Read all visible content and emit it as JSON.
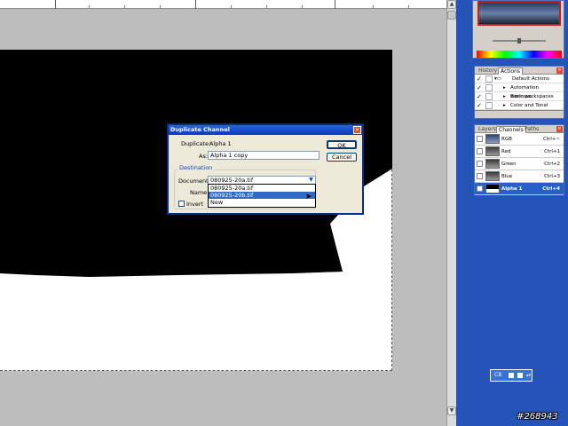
{
  "dialog": {
    "title": "Duplicate Channel",
    "close_glyph": "×",
    "duplicate_label": "Duplicate:",
    "duplicate_value": "Alpha 1",
    "as_label": "As:",
    "as_value": "Alpha 1 copy",
    "ok_label": "OK",
    "cancel_label": "Cancel",
    "destination_label": "Destination",
    "document_label": "Document:",
    "document_value": "080925-20a.tif",
    "name_label": "Name",
    "invert_label": "Invert",
    "dropdown_options": [
      "080925-20a.tif",
      "080925-20b.tif",
      "New"
    ],
    "selected_option": "080925-20b.tif"
  },
  "history_actions": {
    "tabs": [
      "History",
      "Actions"
    ],
    "items": [
      {
        "label": "Default Actions",
        "checked": true,
        "type": "folder"
      },
      {
        "label": "Automation workspa...",
        "checked": true,
        "type": "action"
      },
      {
        "label": "Basic workspaces",
        "checked": true,
        "type": "action"
      },
      {
        "label": "Color and Tonal Corr...",
        "checked": true,
        "type": "action"
      }
    ]
  },
  "channels": {
    "tabs": [
      "Layers",
      "Channels",
      "Paths"
    ],
    "items": [
      {
        "name": "RGB",
        "shortcut": "Ctrl+~"
      },
      {
        "name": "Red",
        "shortcut": "Ctrl+1"
      },
      {
        "name": "Green",
        "shortcut": "Ctrl+2"
      },
      {
        "name": "Blue",
        "shortcut": "Ctrl+3"
      },
      {
        "name": "Alpha 1",
        "shortcut": "Ctrl+4",
        "selected": true
      }
    ]
  },
  "tool_options": {
    "label": "CB"
  },
  "watermark": "#268943",
  "colors": {
    "panel_bg": "#2454b8",
    "dialog_bg": "#ece9d8",
    "selection": "#316ac5",
    "title_bar": "#0a3ab8"
  },
  "icons": [
    "close-icon",
    "dropdown-arrow-icon",
    "eye-icon",
    "folder-icon",
    "checkmark-icon",
    "cursor-icon"
  ]
}
